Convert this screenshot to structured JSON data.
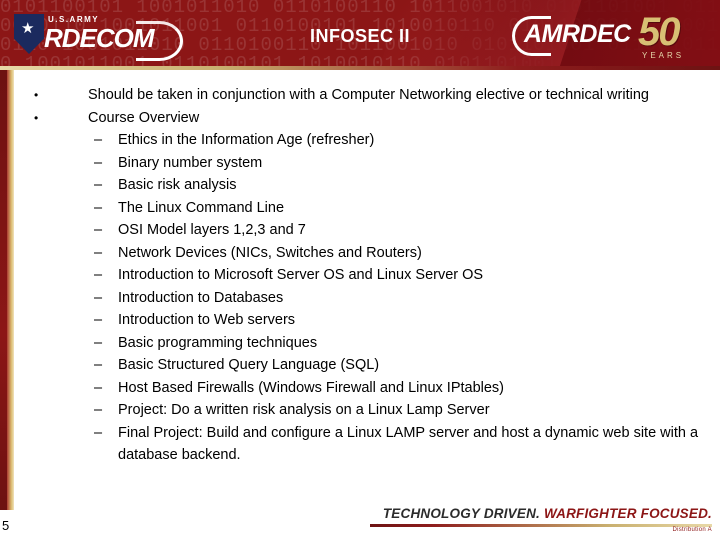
{
  "header": {
    "title": "INFOSEC II",
    "left_logo": {
      "army_text": "U.S.ARMY",
      "wordmark": "RDECOM"
    },
    "right_logo": {
      "wordmark": "AMRDEC",
      "anniversary": "50",
      "anniversary_label": "YEARS"
    },
    "binary_texture": "0101100101 1001011010 0110100110 1011001010 0101101001 0110010110 1001011001 0110100101 1010010110 0101101001 0110010110 1001011010 0110100110 1011001010 0101101001 0110010110 1001011001 0110100101 1010010110 0101101001"
  },
  "content": {
    "items": [
      {
        "level": 1,
        "marker": "•",
        "text": "Should be taken in conjunction with a Computer Networking elective or technical writing"
      },
      {
        "level": 1,
        "marker": "•",
        "text": "Course Overview"
      },
      {
        "level": 2,
        "marker": "–",
        "text": "Ethics in the Information Age (refresher)"
      },
      {
        "level": 2,
        "marker": "–",
        "text": "Binary number system"
      },
      {
        "level": 2,
        "marker": "–",
        "text": "Basic risk analysis"
      },
      {
        "level": 2,
        "marker": "–",
        "text": "The Linux Command Line"
      },
      {
        "level": 2,
        "marker": "–",
        "text": "OSI Model layers 1,2,3 and 7"
      },
      {
        "level": 2,
        "marker": "–",
        "text": "Network Devices (NICs, Switches and Routers)"
      },
      {
        "level": 2,
        "marker": "–",
        "text": "Introduction to Microsoft Server OS and Linux Server OS"
      },
      {
        "level": 2,
        "marker": "–",
        "text": "Introduction to Databases"
      },
      {
        "level": 2,
        "marker": "–",
        "text": "Introduction to Web servers"
      },
      {
        "level": 2,
        "marker": "–",
        "text": "Basic programming techniques"
      },
      {
        "level": 2,
        "marker": "–",
        "text": "Basic Structured Query Language (SQL)"
      },
      {
        "level": 2,
        "marker": "–",
        "text": "Host Based Firewalls (Windows Firewall and Linux IPtables)"
      },
      {
        "level": 2,
        "marker": "–",
        "text": "Project: Do a written risk analysis on a Linux Lamp Server"
      },
      {
        "level": 2,
        "marker": "–",
        "text": "Final Project: Build and configure a Linux LAMP server and host a dynamic web site with a database backend."
      }
    ]
  },
  "footer": {
    "tagline_lead": "TECHNOLOGY DRIVEN.",
    "tagline_tail": "WARFIGHTER FOCUSED.",
    "sub_note": "Distribution A",
    "page_number": "5"
  },
  "colors": {
    "banner_red": "#8c1616",
    "gold": "#d8bf74",
    "text": "#000000"
  }
}
